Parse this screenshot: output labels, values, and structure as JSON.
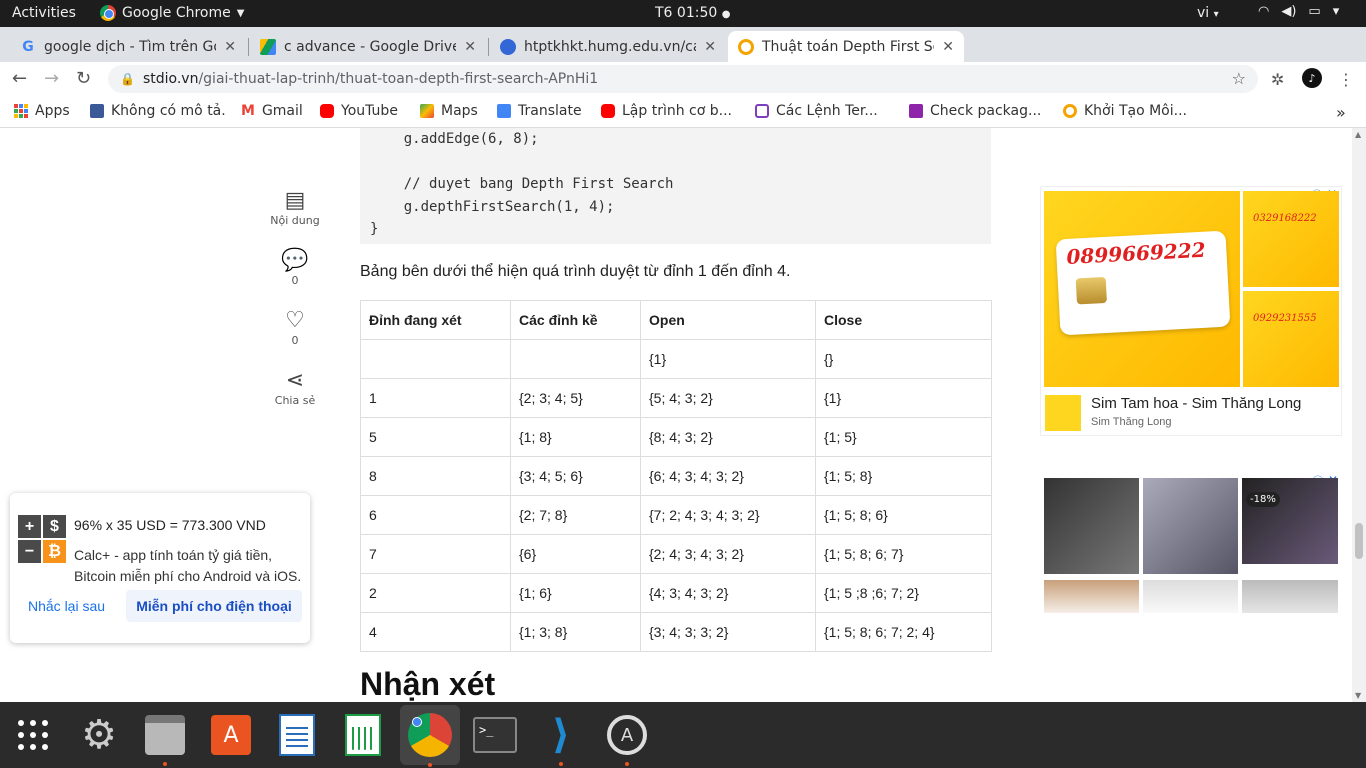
{
  "system": {
    "activities": "Activities",
    "app_name": "Google Chrome",
    "clock": "T6 01:50",
    "language": "vi"
  },
  "tabs": [
    {
      "title": "google dịch - Tìm trên Go",
      "favicon": "google-icon",
      "color": "#4285f4"
    },
    {
      "title": "c advance - Google Drive",
      "favicon": "drive-icon",
      "color": "#0f9d58"
    },
    {
      "title": "htptkhkt.humg.edu.vn/ca",
      "favicon": "humg-icon",
      "color": "#3367d6"
    },
    {
      "title": "Thuật toán Depth First Se",
      "favicon": "stdio-icon",
      "color": "#f4a300"
    }
  ],
  "address": {
    "domain": "stdio.vn",
    "path": "/giai-thuat-lap-trinh/thuat-toan-depth-first-search-APnHi1"
  },
  "bookmarks": [
    {
      "label": "Apps",
      "icon": "apps-grid-icon",
      "color": "#4285f4"
    },
    {
      "label": "Không có mô tả.",
      "icon": "facebook-icon",
      "color": "#3b5998"
    },
    {
      "label": "Gmail",
      "icon": "gmail-icon",
      "color": "#ea4335"
    },
    {
      "label": "YouTube",
      "icon": "youtube-icon",
      "color": "#ff0000"
    },
    {
      "label": "Maps",
      "icon": "maps-icon",
      "color": "#34a853"
    },
    {
      "label": "Translate",
      "icon": "translate-icon",
      "color": "#4285f4"
    },
    {
      "label": "Lập trình cơ b...",
      "icon": "youtube-icon",
      "color": "#ff0000"
    },
    {
      "label": "Các Lệnh Ter...",
      "icon": "terminal-bookmark-icon",
      "color": "#7e3fbf"
    },
    {
      "label": "Check packag...",
      "icon": "package-icon",
      "color": "#8e24aa"
    },
    {
      "label": "Khởi Tạo Môi...",
      "icon": "stdio-icon",
      "color": "#f4a300"
    }
  ],
  "code_lines": [
    "    g.addEdge(6, 8);",
    "",
    "    // duyet bang Depth First Search",
    "    g.depthFirstSearch(1, 4);",
    "}"
  ],
  "side_actions": {
    "contents_label": "Nội dung",
    "comment_count": "0",
    "like_count": "0",
    "share_label": "Chia sẻ"
  },
  "paragraph": "Bảng bên dưới thể hiện quá trình duyệt từ đỉnh 1 đến đỉnh 4.",
  "table": {
    "headers": [
      "Đỉnh đang xét",
      "Các đỉnh kề",
      "Open",
      "Close"
    ],
    "rows": [
      [
        "",
        "",
        "{1}",
        "{}"
      ],
      [
        "1",
        "{2; 3; 4; 5}",
        "{5; 4; 3; 2}",
        "{1}"
      ],
      [
        "5",
        "{1; 8}",
        "{8; 4; 3; 2}",
        "{1; 5}"
      ],
      [
        "8",
        "{3; 4; 5; 6}",
        "{6; 4; 3; 4; 3; 2}",
        "{1; 5; 8}"
      ],
      [
        "6",
        "{2; 7; 8}",
        "{7; 2; 4; 3; 4; 3; 2}",
        "{1; 5; 8; 6}"
      ],
      [
        "7",
        "{6}",
        "{2; 4; 3; 4; 3; 2}",
        "{1; 5; 8; 6; 7}"
      ],
      [
        "2",
        "{1; 6}",
        "{4; 3; 4; 3; 2}",
        "{1; 5 ;8 ;6; 7; 2}"
      ],
      [
        "4",
        "{1; 3; 8}",
        "{3; 4; 3; 3; 2}",
        "{1; 5; 8; 6; 7; 2; 4}"
      ]
    ]
  },
  "next_heading": "Nhận xét",
  "ad1": {
    "big_number": "0899669222",
    "small_number_1": "0329168222",
    "small_number_2": "0929231555",
    "title": "Sim Tam hoa - Sim Thăng Long",
    "subtitle": "Sim Thăng Long"
  },
  "ad2": {
    "discount": "-18%"
  },
  "toast": {
    "line1": "96% x 35 USD = 773.300 VND",
    "line2": "Calc+ - app tính toán tỷ giá tiền, Bitcoin miễn phí cho Android và iOS.",
    "later": "Nhắc lại sau",
    "free": "Miễn phí cho điện thoại",
    "calc_keys": [
      "+",
      "$",
      "−",
      "₿"
    ]
  },
  "dock": [
    {
      "name": "show-apps-icon",
      "color": "#2b2b2b"
    },
    {
      "name": "settings-icon",
      "color": "#7a7a7a"
    },
    {
      "name": "files-icon",
      "color": "#b8b8b8"
    },
    {
      "name": "software-center-icon",
      "color": "#e95420"
    },
    {
      "name": "writer-icon",
      "color": "#2a6ebb"
    },
    {
      "name": "calc-icon",
      "color": "#1e9b45"
    },
    {
      "name": "chrome-icon",
      "color": "#4285f4"
    },
    {
      "name": "terminal-icon",
      "color": "#333333"
    },
    {
      "name": "vscode-icon",
      "color": "#1f8ad2"
    },
    {
      "name": "updater-icon",
      "color": "#555555"
    }
  ]
}
